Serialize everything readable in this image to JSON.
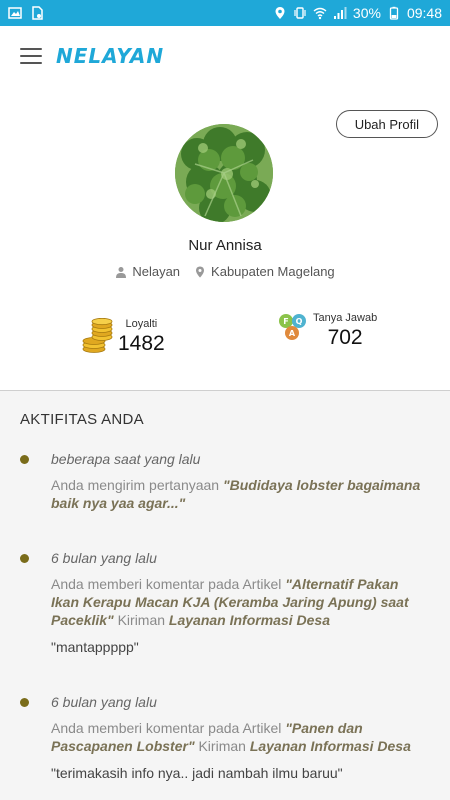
{
  "status_bar": {
    "battery": "30%",
    "time": "09:48",
    "icons": [
      "image-icon",
      "sim-icon",
      "location-icon",
      "vibrate-icon",
      "wifi-icon",
      "signal-icon",
      "battery-icon"
    ]
  },
  "header": {
    "brand": "NELAYAN"
  },
  "profile": {
    "edit_label": "Ubah Profil",
    "name": "Nur Annisa",
    "role": "Nelayan",
    "location": "Kabupaten Magelang"
  },
  "stats": {
    "loyalty_label": "Loyalti",
    "loyalty_value": "1482",
    "qa_label": "Tanya Jawab",
    "qa_value": "702"
  },
  "activity": {
    "title": "AKTIFITAS ANDA",
    "items": [
      {
        "time": "beberapa saat yang lalu",
        "prefix": "Anda mengirim pertanyaan ",
        "subject": "\"Budidaya lobster bagaimana baik nya yaa agar...\"",
        "connector": "",
        "source": "",
        "quote": ""
      },
      {
        "time": "6 bulan yang lalu",
        "prefix": "Anda memberi komentar pada Artikel ",
        "subject": "\"Alternatif Pakan Ikan Kerapu Macan KJA (Keramba Jaring Apung) saat Paceklik\"",
        "connector": " Kiriman ",
        "source": "Layanan Informasi Desa",
        "quote": "\"mantappppp\""
      },
      {
        "time": "6 bulan yang lalu",
        "prefix": "Anda memberi komentar pada Artikel ",
        "subject": "\"Panen dan Pascapanen Lobster\"",
        "connector": " Kiriman ",
        "source": "Layanan Informasi Desa",
        "quote": "\"terimakasih info nya.. jadi nambah ilmu baruu\""
      }
    ]
  },
  "colors": {
    "primary": "#1fa8d8",
    "bullet": "#7a6c1a",
    "emphasis": "#7a7256"
  }
}
